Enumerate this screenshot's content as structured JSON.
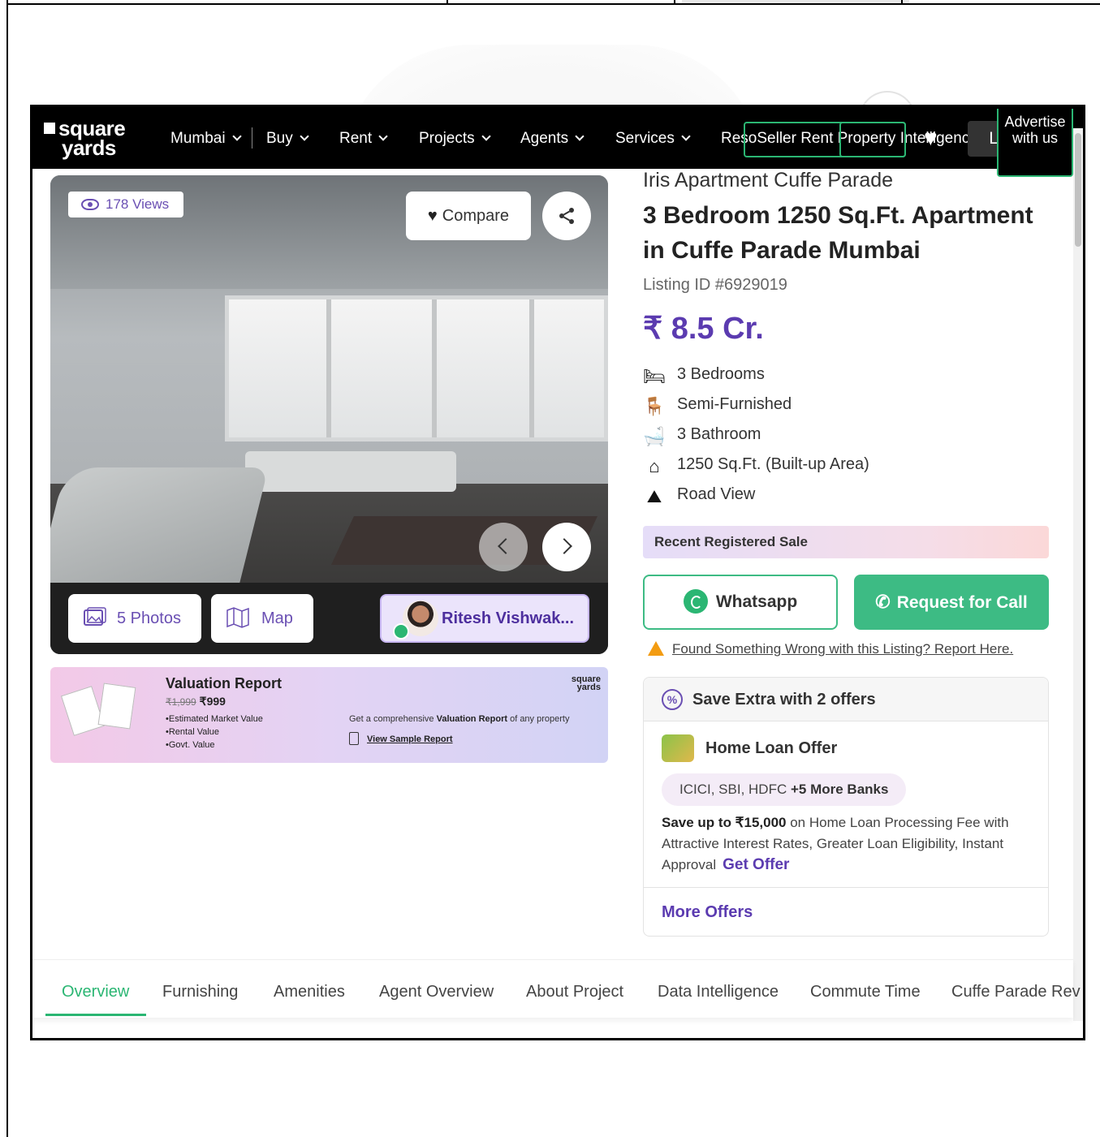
{
  "nav": {
    "logo_line1": "square",
    "logo_line2": "yards",
    "city": "Mumbai",
    "items": [
      "Buy",
      "Rent",
      "Projects",
      "Agents",
      "Services"
    ],
    "overlap_text": "ResoSeller Rent Property Intelligence",
    "login": "Login",
    "advertise": "Advertise with us"
  },
  "gallery": {
    "views": "178 Views",
    "compare": "Compare",
    "photos": "5 Photos",
    "map": "Map",
    "agent": "Ritesh Vishwak..."
  },
  "valuation": {
    "title": "Valuation Report",
    "old_price": "₹1,999",
    "price": "₹999",
    "bullets": [
      "Estimated Market Value",
      "Rental Value",
      "Govt. Value"
    ],
    "logo": "square yards",
    "desc_prefix": "Get a comprehensive ",
    "desc_bold": "Valuation Report",
    "desc_suffix": " of any property",
    "sample": "View Sample Report"
  },
  "listing": {
    "project": "Iris Apartment Cuffe Parade",
    "title": "3 Bedroom 1250 Sq.Ft. Apartment in Cuffe Parade Mumbai",
    "listing_id": "Listing ID #6929019",
    "price": "₹ 8.5 Cr.",
    "features": [
      {
        "icon": "bed-icon",
        "text": "3 Bedrooms"
      },
      {
        "icon": "sofa-icon",
        "text": "Semi-Furnished"
      },
      {
        "icon": "bathtub-icon",
        "text": "3 Bathroom"
      },
      {
        "icon": "home-icon",
        "text": "1250 Sq.Ft. (Built-up Area)"
      },
      {
        "icon": "view-icon",
        "text": "Road View"
      }
    ],
    "recent_sale": "Recent Registered Sale",
    "whatsapp": "Whatsapp",
    "request_call": "Request for Call",
    "report": "Found Something Wrong with this Listing? Report Here."
  },
  "offers": {
    "heading": "Save Extra with 2 offers",
    "loan_title": "Home Loan Offer",
    "banks_prefix": "ICICI, SBI, HDFC ",
    "banks_more": "+5 More Banks",
    "desc_bold": "Save up to ₹15,000",
    "desc_rest": " on Home Loan Processing Fee with Attractive Interest Rates, Greater Loan Eligibility, Instant Approval",
    "get_offer": "Get Offer",
    "more_offers": "More Offers"
  },
  "tabs": [
    "Overview",
    "Furnishing",
    "Amenities",
    "Agent Overview",
    "About Project",
    "Data Intelligence",
    "Commute Time",
    "Cuffe Parade Rev"
  ],
  "colors": {
    "accent": "#5b3bb0",
    "green": "#2bb673"
  }
}
